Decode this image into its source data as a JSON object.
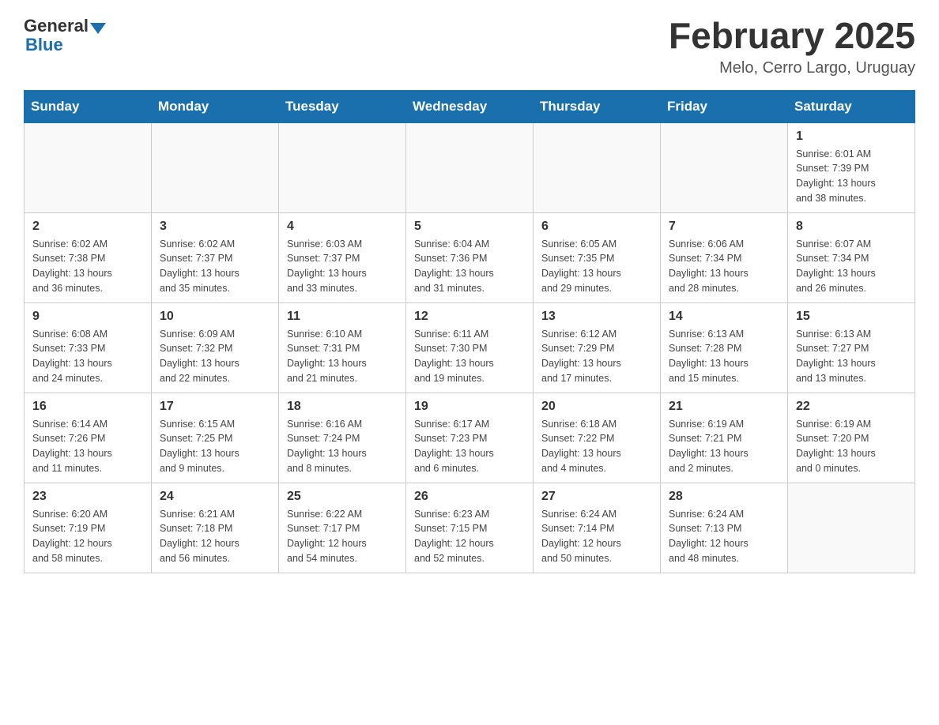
{
  "header": {
    "logo_general": "General",
    "logo_blue": "Blue",
    "title": "February 2025",
    "subtitle": "Melo, Cerro Largo, Uruguay"
  },
  "days_of_week": [
    "Sunday",
    "Monday",
    "Tuesday",
    "Wednesday",
    "Thursday",
    "Friday",
    "Saturday"
  ],
  "weeks": [
    [
      {
        "day": "",
        "info": ""
      },
      {
        "day": "",
        "info": ""
      },
      {
        "day": "",
        "info": ""
      },
      {
        "day": "",
        "info": ""
      },
      {
        "day": "",
        "info": ""
      },
      {
        "day": "",
        "info": ""
      },
      {
        "day": "1",
        "info": "Sunrise: 6:01 AM\nSunset: 7:39 PM\nDaylight: 13 hours\nand 38 minutes."
      }
    ],
    [
      {
        "day": "2",
        "info": "Sunrise: 6:02 AM\nSunset: 7:38 PM\nDaylight: 13 hours\nand 36 minutes."
      },
      {
        "day": "3",
        "info": "Sunrise: 6:02 AM\nSunset: 7:37 PM\nDaylight: 13 hours\nand 35 minutes."
      },
      {
        "day": "4",
        "info": "Sunrise: 6:03 AM\nSunset: 7:37 PM\nDaylight: 13 hours\nand 33 minutes."
      },
      {
        "day": "5",
        "info": "Sunrise: 6:04 AM\nSunset: 7:36 PM\nDaylight: 13 hours\nand 31 minutes."
      },
      {
        "day": "6",
        "info": "Sunrise: 6:05 AM\nSunset: 7:35 PM\nDaylight: 13 hours\nand 29 minutes."
      },
      {
        "day": "7",
        "info": "Sunrise: 6:06 AM\nSunset: 7:34 PM\nDaylight: 13 hours\nand 28 minutes."
      },
      {
        "day": "8",
        "info": "Sunrise: 6:07 AM\nSunset: 7:34 PM\nDaylight: 13 hours\nand 26 minutes."
      }
    ],
    [
      {
        "day": "9",
        "info": "Sunrise: 6:08 AM\nSunset: 7:33 PM\nDaylight: 13 hours\nand 24 minutes."
      },
      {
        "day": "10",
        "info": "Sunrise: 6:09 AM\nSunset: 7:32 PM\nDaylight: 13 hours\nand 22 minutes."
      },
      {
        "day": "11",
        "info": "Sunrise: 6:10 AM\nSunset: 7:31 PM\nDaylight: 13 hours\nand 21 minutes."
      },
      {
        "day": "12",
        "info": "Sunrise: 6:11 AM\nSunset: 7:30 PM\nDaylight: 13 hours\nand 19 minutes."
      },
      {
        "day": "13",
        "info": "Sunrise: 6:12 AM\nSunset: 7:29 PM\nDaylight: 13 hours\nand 17 minutes."
      },
      {
        "day": "14",
        "info": "Sunrise: 6:13 AM\nSunset: 7:28 PM\nDaylight: 13 hours\nand 15 minutes."
      },
      {
        "day": "15",
        "info": "Sunrise: 6:13 AM\nSunset: 7:27 PM\nDaylight: 13 hours\nand 13 minutes."
      }
    ],
    [
      {
        "day": "16",
        "info": "Sunrise: 6:14 AM\nSunset: 7:26 PM\nDaylight: 13 hours\nand 11 minutes."
      },
      {
        "day": "17",
        "info": "Sunrise: 6:15 AM\nSunset: 7:25 PM\nDaylight: 13 hours\nand 9 minutes."
      },
      {
        "day": "18",
        "info": "Sunrise: 6:16 AM\nSunset: 7:24 PM\nDaylight: 13 hours\nand 8 minutes."
      },
      {
        "day": "19",
        "info": "Sunrise: 6:17 AM\nSunset: 7:23 PM\nDaylight: 13 hours\nand 6 minutes."
      },
      {
        "day": "20",
        "info": "Sunrise: 6:18 AM\nSunset: 7:22 PM\nDaylight: 13 hours\nand 4 minutes."
      },
      {
        "day": "21",
        "info": "Sunrise: 6:19 AM\nSunset: 7:21 PM\nDaylight: 13 hours\nand 2 minutes."
      },
      {
        "day": "22",
        "info": "Sunrise: 6:19 AM\nSunset: 7:20 PM\nDaylight: 13 hours\nand 0 minutes."
      }
    ],
    [
      {
        "day": "23",
        "info": "Sunrise: 6:20 AM\nSunset: 7:19 PM\nDaylight: 12 hours\nand 58 minutes."
      },
      {
        "day": "24",
        "info": "Sunrise: 6:21 AM\nSunset: 7:18 PM\nDaylight: 12 hours\nand 56 minutes."
      },
      {
        "day": "25",
        "info": "Sunrise: 6:22 AM\nSunset: 7:17 PM\nDaylight: 12 hours\nand 54 minutes."
      },
      {
        "day": "26",
        "info": "Sunrise: 6:23 AM\nSunset: 7:15 PM\nDaylight: 12 hours\nand 52 minutes."
      },
      {
        "day": "27",
        "info": "Sunrise: 6:24 AM\nSunset: 7:14 PM\nDaylight: 12 hours\nand 50 minutes."
      },
      {
        "day": "28",
        "info": "Sunrise: 6:24 AM\nSunset: 7:13 PM\nDaylight: 12 hours\nand 48 minutes."
      },
      {
        "day": "",
        "info": ""
      }
    ]
  ]
}
